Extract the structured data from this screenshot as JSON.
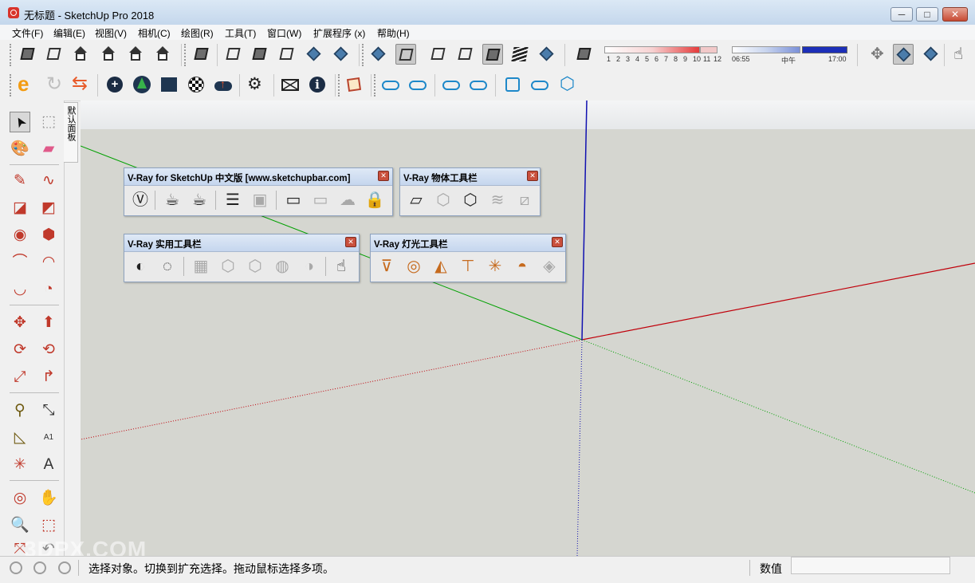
{
  "window": {
    "title": "无标题 - SketchUp Pro 2018",
    "min_glyph": "─",
    "max_glyph": "□",
    "close_glyph": "✕"
  },
  "menu": [
    "文件(F)",
    "编辑(E)",
    "视图(V)",
    "相机(C)",
    "绘图(R)",
    "工具(T)",
    "窗口(W)",
    "扩展程序 (x)",
    "帮助(H)"
  ],
  "shadows": {
    "months": [
      "1",
      "2",
      "3",
      "4",
      "5",
      "6",
      "7",
      "8",
      "9",
      "10",
      "11",
      "12"
    ],
    "time_start": "06:55",
    "time_mid": "中午",
    "time_end": "17:00"
  },
  "tray_tab": "默认面板",
  "vray_panels": {
    "main": {
      "title": "V-Ray for SketchUp 中文版 [www.sketchupbar.com]"
    },
    "object": {
      "title": "V-Ray 物体工具栏"
    },
    "utility": {
      "title": "V-Ray 实用工具栏"
    },
    "light": {
      "title": "V-Ray 灯光工具栏"
    }
  },
  "status": {
    "message": "选择对象。切换到扩充选择。拖动鼠标选择多项。",
    "measure_label": "数值",
    "measure_value": ""
  },
  "watermark": "3DPX.COM",
  "colors": {
    "red_axis": "#c0000a",
    "green_axis": "#00a000",
    "blue_axis": "#1010b0",
    "vray_orange": "#c66a1d"
  }
}
